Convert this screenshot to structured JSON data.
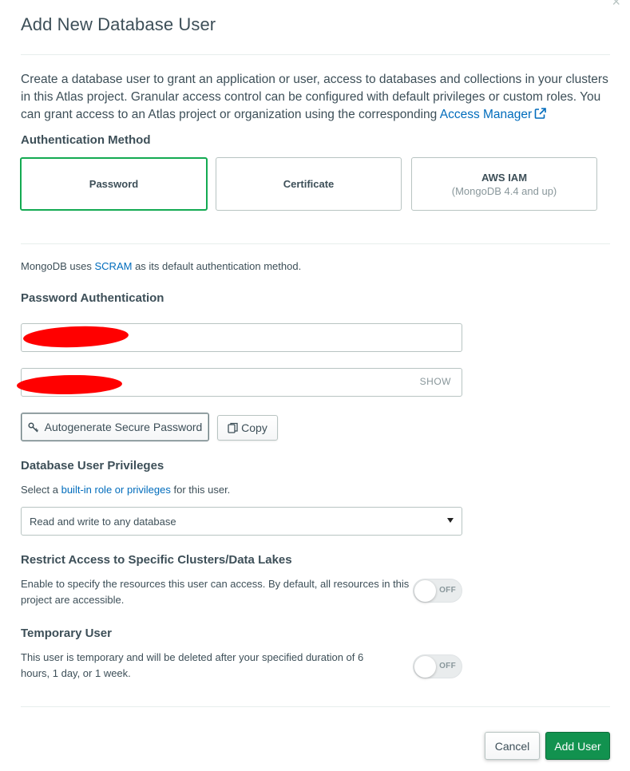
{
  "dialog": {
    "title": "Add New Database User",
    "close_glyph": "×"
  },
  "intro": {
    "text": "Create a database user to grant an application or user, access to databases and collections in your clusters in this Atlas project. Granular access control can be configured with default privileges or custom roles. You can grant access to an Atlas project or organization using the corresponding ",
    "link_label": "Access Manager",
    "link_icon": "external-link-icon"
  },
  "auth_method": {
    "heading": "Authentication Method",
    "options": [
      {
        "label": "Password",
        "sub": "",
        "selected": true
      },
      {
        "label": "Certificate",
        "sub": "",
        "selected": false
      },
      {
        "label": "AWS IAM",
        "sub": "(MongoDB 4.4 and up)",
        "selected": false
      }
    ]
  },
  "scram_note": {
    "prefix": "MongoDB uses ",
    "link": "SCRAM",
    "suffix": " as its default authentication method."
  },
  "password_auth": {
    "heading": "Password Authentication",
    "username_value": "",
    "password_value": "",
    "show_label": "SHOW",
    "autogenerate_label": "Autogenerate Secure Password",
    "copy_label": "Copy"
  },
  "privileges": {
    "heading": "Database User Privileges",
    "desc_prefix": "Select a ",
    "desc_link": "built-in role or privileges",
    "desc_suffix": " for this user.",
    "selected_option": "Read and write to any database"
  },
  "restrict": {
    "heading": "Restrict Access to Specific Clusters/Data Lakes",
    "desc": "Enable to specify the resources this user can access. By default, all resources in this project are accessible.",
    "toggle_state": "OFF"
  },
  "temporary": {
    "heading": "Temporary User",
    "desc": "This user is temporary and will be deleted after your specified duration of 6 hours, 1 day, or 1 week.",
    "toggle_state": "OFF"
  },
  "footer": {
    "cancel_label": "Cancel",
    "add_label": "Add User"
  },
  "colors": {
    "accent_green": "#13aa52",
    "button_green": "#12924f",
    "link_blue": "#006cbc",
    "redaction_red": "#ff0000"
  }
}
